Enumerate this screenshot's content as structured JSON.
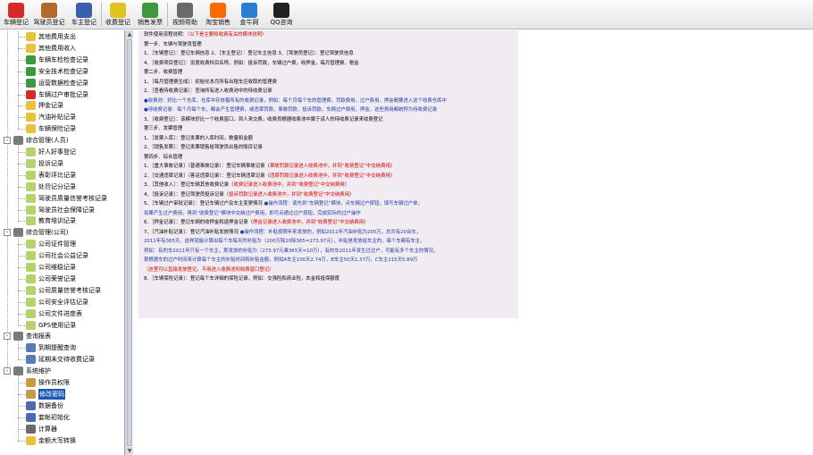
{
  "toolbar": [
    {
      "label": "车辆登记",
      "icon": "red-car-icon",
      "color": "#d62a2a"
    },
    {
      "label": "驾驶员登记",
      "icon": "driver-icon",
      "color": "#b06a2a"
    },
    {
      "label": "车主登记",
      "icon": "owner-icon",
      "color": "#3a5fb0"
    },
    {
      "label": "收费登记",
      "icon": "fee-puzzle-icon",
      "color": "#e2c21c"
    },
    {
      "label": "销售发票",
      "icon": "invoice-icon",
      "color": "#3c9a3c"
    },
    {
      "label": "视频帮助",
      "icon": "video-icon",
      "color": "#6a6a6a"
    },
    {
      "label": "淘宝销售",
      "icon": "taobao-icon",
      "color": "#ff6a00"
    },
    {
      "label": "金牛网",
      "icon": "network-icon",
      "color": "#2a80d0"
    },
    {
      "label": "QQ咨询",
      "icon": "qq-icon",
      "color": "#222222"
    }
  ],
  "tree": {
    "items": [
      {
        "label": "其他费用支出",
        "icon": "coin-icon",
        "color": "#e8c23a",
        "level": 2
      },
      {
        "label": "其他费用收入",
        "icon": "coin-icon",
        "color": "#e8c23a",
        "level": 2
      },
      {
        "label": "车辆车检检查记录",
        "icon": "car-icon",
        "color": "#3c9a3c",
        "level": 2
      },
      {
        "label": "安全技术检查记录",
        "icon": "car-icon",
        "color": "#3c9a3c",
        "level": 2
      },
      {
        "label": "运营数据检查记录",
        "icon": "car-icon",
        "color": "#3c9a3c",
        "level": 2
      },
      {
        "label": "车辆过户审批记录",
        "icon": "red-car-icon",
        "color": "#d62a2a",
        "level": 2
      },
      {
        "label": "押金记录",
        "icon": "coin-icon",
        "color": "#e8c23a",
        "level": 2
      },
      {
        "label": "汽油补贴记录",
        "icon": "coin-icon",
        "color": "#e8c23a",
        "level": 2
      },
      {
        "label": "车辆保险记录",
        "icon": "coin-icon",
        "color": "#e8c23a",
        "level": 2
      },
      {
        "label": "综合管理(人员)",
        "icon": "gear-icon",
        "color": "#7a7a7a",
        "level": 1,
        "expander": "-"
      },
      {
        "label": "好人好事登记",
        "icon": "folder-icon",
        "color": "#b6d26a",
        "level": 2
      },
      {
        "label": "投诉记录",
        "icon": "folder-icon",
        "color": "#b6d26a",
        "level": 2
      },
      {
        "label": "表彰评比记录",
        "icon": "folder-icon",
        "color": "#b6d26a",
        "level": 2
      },
      {
        "label": "处罚记分记录",
        "icon": "folder-icon",
        "color": "#b6d26a",
        "level": 2
      },
      {
        "label": "驾驶员质量信誉考核记录",
        "icon": "folder-icon",
        "color": "#b6d26a",
        "level": 2
      },
      {
        "label": "驾驶员社会保障记录",
        "icon": "folder-icon",
        "color": "#b6d26a",
        "level": 2
      },
      {
        "label": "教育培训记录",
        "icon": "folder-icon",
        "color": "#b6d26a",
        "level": 2
      },
      {
        "label": "综合管理(公司)",
        "icon": "gear-icon",
        "color": "#7a7a7a",
        "level": 1,
        "expander": "-"
      },
      {
        "label": "公司证件管理",
        "icon": "folder-icon",
        "color": "#b6d26a",
        "level": 2
      },
      {
        "label": "公司社会公益记录",
        "icon": "folder-icon",
        "color": "#b6d26a",
        "level": 2
      },
      {
        "label": "公司维稳记录",
        "icon": "folder-icon",
        "color": "#b6d26a",
        "level": 2
      },
      {
        "label": "公司荣誉记录",
        "icon": "folder-icon",
        "color": "#b6d26a",
        "level": 2
      },
      {
        "label": "公司质量信誉考核记录",
        "icon": "folder-icon",
        "color": "#b6d26a",
        "level": 2
      },
      {
        "label": "公司安全评估记录",
        "icon": "folder-icon",
        "color": "#b6d26a",
        "level": 2
      },
      {
        "label": "公司文件进度表",
        "icon": "folder-icon",
        "color": "#b6d26a",
        "level": 2
      },
      {
        "label": "GPS使用记录",
        "icon": "folder-icon",
        "color": "#b6d26a",
        "level": 2
      },
      {
        "label": "查询报表",
        "icon": "gear-icon",
        "color": "#7a7a7a",
        "level": 1,
        "expander": "-"
      },
      {
        "label": "到期提醒查询",
        "icon": "clock-icon",
        "color": "#5a7ab8",
        "level": 2
      },
      {
        "label": "延期未交待收费记录",
        "icon": "clock-icon",
        "color": "#5a7ab8",
        "level": 2
      },
      {
        "label": "系统维护",
        "icon": "gear-icon",
        "color": "#7a7a7a",
        "level": 1,
        "expander": "-"
      },
      {
        "label": "操作员权限",
        "icon": "user-icon",
        "color": "#c79a4a",
        "level": 2
      },
      {
        "label": "修改密码",
        "icon": "user-icon",
        "color": "#c79a4a",
        "level": 2,
        "selected": true
      },
      {
        "label": "数据备份",
        "icon": "disk-icon",
        "color": "#4a6ab0",
        "level": 2
      },
      {
        "label": "套帐初始化",
        "icon": "disk-icon",
        "color": "#4a6ab0",
        "level": 2
      },
      {
        "label": "计算器",
        "icon": "calculator-icon",
        "color": "#6a6a6a",
        "level": 2
      },
      {
        "label": "金额大写转换",
        "icon": "coin-icon",
        "color": "#e8c23a",
        "level": 2
      }
    ]
  },
  "content": {
    "lines": [
      [
        {
          "t": "软件使用流程说明："
        },
        {
          "t": "（以下是主要和收费有关的模块说明）",
          "c": "red"
        }
      ],
      [
        {
          "t": "第一步、车辆与驾驶员管理"
        }
      ],
      [
        {
          "t": "1、［车辆登记］：登记车辆信息    2、［车主登记］：登记车主信息    3、［驾驶员登记］：登记驾驶员信息"
        }
      ],
      [
        {
          "t": "4、［收费项目登记］：设置收费科目名称，例如：投诉罚款，车辆过户费，收押金，每月管理费，税金"
        }
      ],
      [
        {
          "t": "第二步、收费管理"
        }
      ],
      [
        {
          "t": "1、［每月管理费生成］：初始化本月所有出租车应收取的管理费"
        }
      ],
      [
        {
          "t": "2、［查看待收费记录］：查询所有进入收费池中的待收费记录"
        }
      ],
      [
        {
          "t": "●收费池：好比一个仓库，仓库中存放着所有的收费记录，例如：每个月每个车的管理费，罚款费用，过户费用，押金都要进入这个收费仓库中",
          "c": "blue"
        }
      ],
      [
        {
          "t": "●待收费记录：每个月每个车，都会产生管理费，或违章罚款，事故罚款，投诉罚款，车辆过户费用，押金，这些费用都统称为待收费记录",
          "c": "blue"
        }
      ],
      [
        {
          "t": "3、［收费登记］：该模块好比一个收费窗口，到人来交费，收费员根据收费池中属于该人的待收费记录来收费登记"
        }
      ],
      [
        {
          "t": "第三步、发票管理"
        }
      ],
      [
        {
          "t": "1、［发票入库］：登记发票的入库时间，数量和金额"
        }
      ],
      [
        {
          "t": "2、［销售发票］：登记发票销售给驾驶员出售的账目记录"
        }
      ],
      [
        {
          "t": "第四步、综合管理"
        }
      ],
      [
        {
          "t": "1、［重大事故记录］（普通事故记录）：登记车辆事故记录（"
        },
        {
          "t": "事故罚款记录进入收费池中，并到“收费登记”中交纳费用",
          "c": "red"
        },
        {
          "t": "）"
        }
      ],
      [
        {
          "t": "2、［交通违章记录］（客运违章记录）：登记车辆违章记录（"
        },
        {
          "t": "违章罚款记录进入收费池中，并到“收费登记”中交纳费用",
          "c": "red"
        },
        {
          "t": "）"
        }
      ],
      [
        {
          "t": "3、［其他收入］：登记车辆其他收费记录（"
        },
        {
          "t": "收费记录进入收费池中，并到“收费登记”中交纳费用",
          "c": "red"
        },
        {
          "t": "）"
        }
      ],
      [
        {
          "t": "4、［投诉记录］：登记驾驶员投诉记录（"
        },
        {
          "t": "投诉罚款记录进入收费池中，并到“收费登记”中交纳费用",
          "c": "red"
        },
        {
          "t": "）"
        }
      ],
      [
        {
          "t": "5、［车辆过户审批记录］：登记车辆过户及车主变更情况    "
        },
        {
          "t": "●操作流程：请先到“车辆登记”模块，点车辆过户按钮，填写车辆过户单，",
          "c": "blue"
        }
      ],
      [
        {
          "t": "    如果产生过户费用，再到“收费登记”模块中交纳过户费用，即可点通过过户按钮，完成实际的过户操作",
          "c": "blue"
        }
      ],
      [
        {
          "t": "6、［押金记录］：登记车辆的收押金和退押金记录（"
        },
        {
          "t": "押金记录进入收费池中，并到“收费登记”中交纳费用",
          "c": "red"
        },
        {
          "t": "）"
        }
      ],
      [
        {
          "t": "7、［汽油补贴记录］：登记汽油补贴发放情况    "
        },
        {
          "t": "●操作流程：补贴按照年来发放的，例如2011年汽油补贴为200万，总共有20台车，",
          "c": "blue"
        }
      ],
      [
        {
          "t": "    2011年有365天，这样就能计算出每个车每天的补贴为（200万除20除365=273.97元），补贴是发放给车主的，每个车都有车主，",
          "c": "blue"
        }
      ],
      [
        {
          "t": "    例如：有的车2011年只有一个车主，那发放的补贴为（273.97元乘365天=10万），有的车2011年发生过过户，可能有多个车主的情况，",
          "c": "blue"
        }
      ],
      [
        {
          "t": "    那根据车的过户时间来计算每个车主的补贴时间和补贴金额，例如A车主100天2.74万，B车主50天1.37万，C车主215天5.89万",
          "c": "blue"
        }
      ],
      [
        {
          "t": "    （这里可以直接发放登记，不用进入收费池到收费窗口登记）",
          "c": "red"
        }
      ],
      [
        {
          "t": "8、［车辆保险记录］：登记每个车详细的保险记录，例如：交强险和商业险，本金和投保额度"
        }
      ]
    ]
  }
}
